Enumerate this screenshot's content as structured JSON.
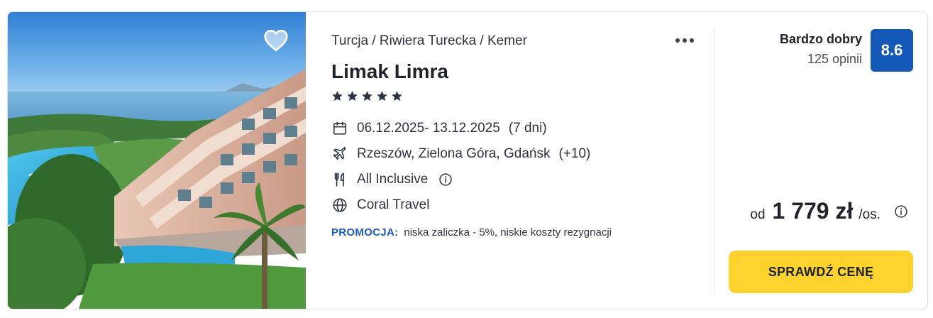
{
  "breadcrumb": "Turcja / Riwiera Turecka / Kemer",
  "hotel": {
    "name": "Limak Limra",
    "stars": 5
  },
  "dates": {
    "range": "06.12.2025- 13.12.2025",
    "duration": "(7 dni)"
  },
  "departure": {
    "cities": "Rzeszów, Zielona Góra, Gdańsk",
    "more": "(+10)"
  },
  "board": {
    "label": "All Inclusive"
  },
  "operator": {
    "label": "Coral Travel"
  },
  "promo": {
    "label": "PROMOCJA:",
    "text": "niska zaliczka - 5%, niskie koszty rezygnacji"
  },
  "rating": {
    "label": "Bardzo dobry",
    "count": "125 opinii",
    "score": "8.6"
  },
  "price": {
    "prefix": "od",
    "amount": "1 779 zł",
    "suffix": "/os."
  },
  "cta": {
    "label": "SPRAWDŹ CENĘ"
  },
  "colors": {
    "score_bg": "#1458b8",
    "cta_bg": "#fcd22c",
    "promo": "#1a5bb8"
  },
  "icons": {
    "favorite": "heart-icon",
    "more": "more-dots-icon",
    "star": "star-icon",
    "dates": "calendar-icon",
    "departure": "plane-icon",
    "board": "utensils-icon",
    "board_info": "info-icon",
    "operator": "globe-icon",
    "price_info": "info-icon"
  }
}
